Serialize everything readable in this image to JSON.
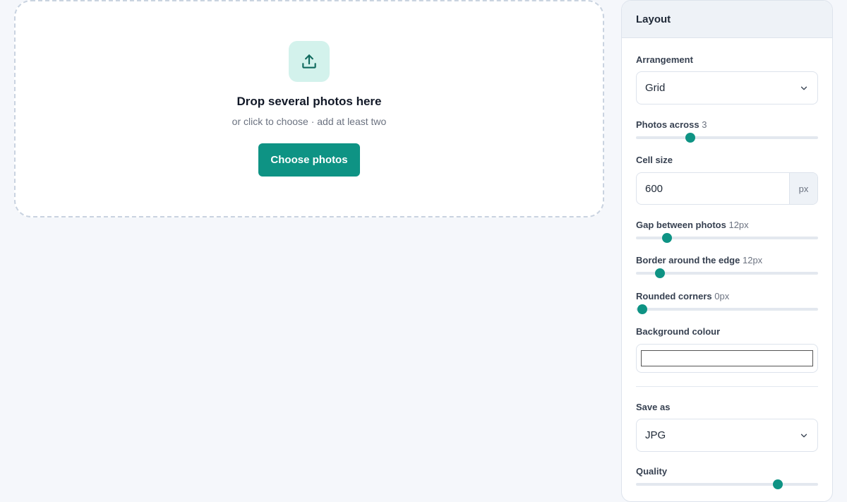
{
  "dropzone": {
    "title": "Drop several photos here",
    "subtitle": "or click to choose · add at least two",
    "button_label": "Choose photos",
    "icon": "upload-icon"
  },
  "panel": {
    "title": "Layout",
    "arrangement": {
      "label": "Arrangement",
      "value": "Grid",
      "icon": "chevron-down-icon"
    },
    "photos_across": {
      "label": "Photos across",
      "value": "3",
      "fraction": 0.3
    },
    "cell_size": {
      "label": "Cell size",
      "value": "600",
      "unit": "px"
    },
    "gap": {
      "label": "Gap between photos",
      "value": "12px",
      "fraction": 0.17
    },
    "border": {
      "label": "Border around the edge",
      "value": "12px",
      "fraction": 0.13
    },
    "corners": {
      "label": "Rounded corners",
      "value": "0px",
      "fraction": 0.035
    },
    "background": {
      "label": "Background colour",
      "color": "#ffffff"
    },
    "save_as": {
      "label": "Save as",
      "value": "JPG",
      "icon": "chevron-down-icon"
    },
    "quality": {
      "label": "Quality",
      "fraction": 0.78
    }
  },
  "colors": {
    "accent": "#0e9384",
    "accent_soft": "#d3f2ec",
    "page_bg": "#f5f7fb"
  }
}
